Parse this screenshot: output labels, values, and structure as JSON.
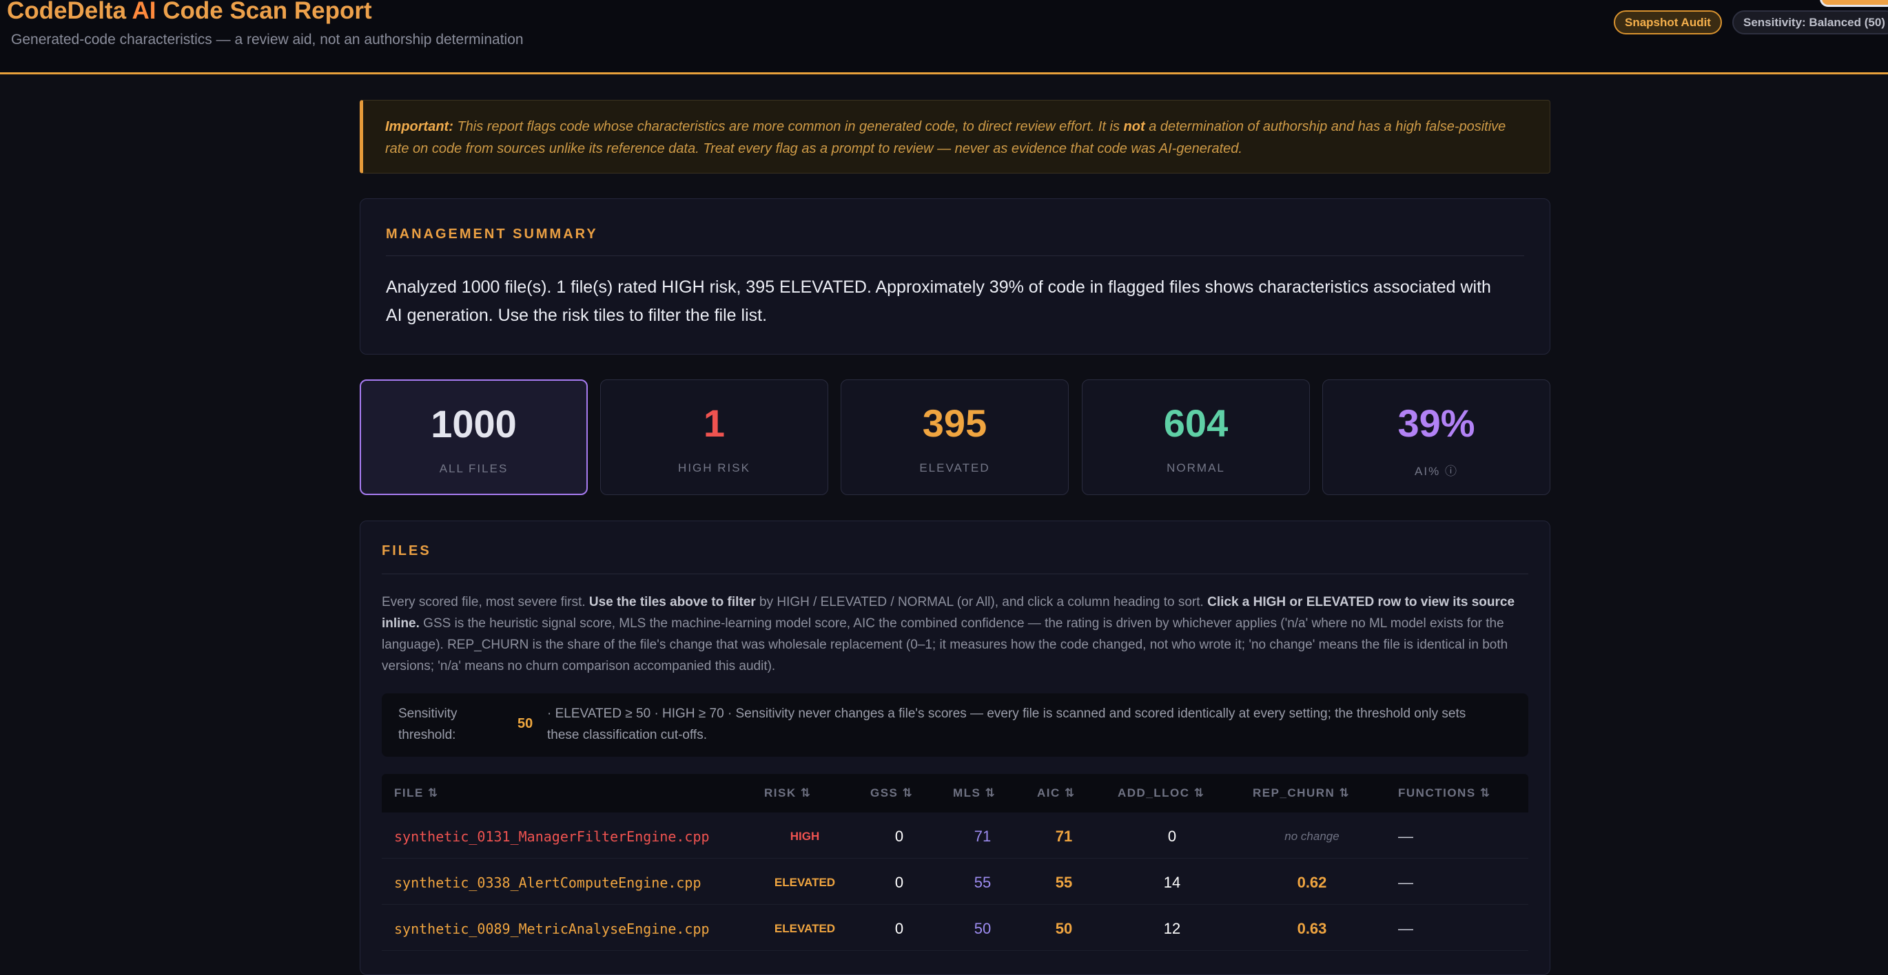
{
  "header": {
    "title_prefix": "CodeDelta ",
    "title_ai": "AI",
    "title_suffix": " Code Scan Report",
    "subtitle": "Generated-code characteristics — a review aid, not an authorship determination",
    "snapshot_badge": "Snapshot Audit",
    "sensitivity_badge": "Sensitivity: Balanced (50)"
  },
  "notice": {
    "lead": "Important:",
    "text_1": " This report flags code whose characteristics are more common in generated code, to direct review effort. It is ",
    "emph": "not",
    "text_2": " a determination of authorship and has a high false-positive rate on code from sources unlike its reference data. Treat every flag as a prompt to review — never as evidence that code was AI-generated."
  },
  "summary": {
    "heading": "MANAGEMENT SUMMARY",
    "text": "Analyzed 1000 file(s). 1 file(s) rated HIGH risk, 395 ELEVATED. Approximately 39% of code in flagged files shows characteristics associated with AI generation. Use the risk tiles to filter the file list."
  },
  "tiles": [
    {
      "value": "1000",
      "label": "ALL FILES",
      "color": "#e4e5ee"
    },
    {
      "value": "1",
      "label": "HIGH RISK",
      "color": "#ef5350"
    },
    {
      "value": "395",
      "label": "ELEVATED",
      "color": "#f0a540"
    },
    {
      "value": "604",
      "label": "NORMAL",
      "color": "#5fd0a6"
    },
    {
      "value": "39%",
      "label": "AI% ⓘ",
      "color": "#b282f5"
    }
  ],
  "files": {
    "heading": "FILES",
    "desc_1": "Every scored file, most severe first. ",
    "desc_b1": "Use the tiles above to filter",
    "desc_2": " by HIGH / ELEVATED / NORMAL (or All), and click a column heading to sort. ",
    "desc_b2": "Click a HIGH or ELEVATED row to view its source inline.",
    "desc_3": " GSS is the heuristic signal score, MLS the machine-learning model score, AIC the combined confidence — the rating is driven by whichever applies ('n/a' where no ML model exists for the language). REP_CHURN is the share of the file's change that was wholesale replacement (0–1; it measures how the code changed, not who wrote it; 'no change' means the file is identical in both versions; 'n/a' means no churn comparison accompanied this audit).",
    "threshold": {
      "label": "Sensitivity threshold:",
      "value": "50",
      "text": "· ELEVATED ≥ 50 · HIGH ≥ 70 · Sensitivity never changes a file's scores — every file is scanned and scored identically at every setting; the threshold only sets these classification cut-offs."
    },
    "columns": [
      "FILE ⇅",
      "RISK ⇅",
      "GSS ⇅",
      "MLS ⇅",
      "AIC ⇅",
      "ADD_LLOC ⇅",
      "REP_CHURN ⇅",
      "FUNCTIONS ⇅"
    ],
    "rows": [
      {
        "file": "synthetic_0131_ManagerFilterEngine.cpp",
        "risk": "HIGH",
        "gss": "0",
        "mls": "71",
        "aic": "71",
        "add_lloc": "0",
        "rep_churn": "no change",
        "functions": "—"
      },
      {
        "file": "synthetic_0338_AlertComputeEngine.cpp",
        "risk": "ELEVATED",
        "gss": "0",
        "mls": "55",
        "aic": "55",
        "add_lloc": "14",
        "rep_churn": "0.62",
        "functions": "—"
      },
      {
        "file": "synthetic_0089_MetricAnalyseEngine.cpp",
        "risk": "ELEVATED",
        "gss": "0",
        "mls": "50",
        "aic": "50",
        "add_lloc": "12",
        "rep_churn": "0.63",
        "functions": "—"
      }
    ],
    "colors": {
      "high": "#ef5350",
      "elevated": "#f0a540",
      "mls": "#9d8cf0",
      "aic": "#f0a540"
    }
  }
}
